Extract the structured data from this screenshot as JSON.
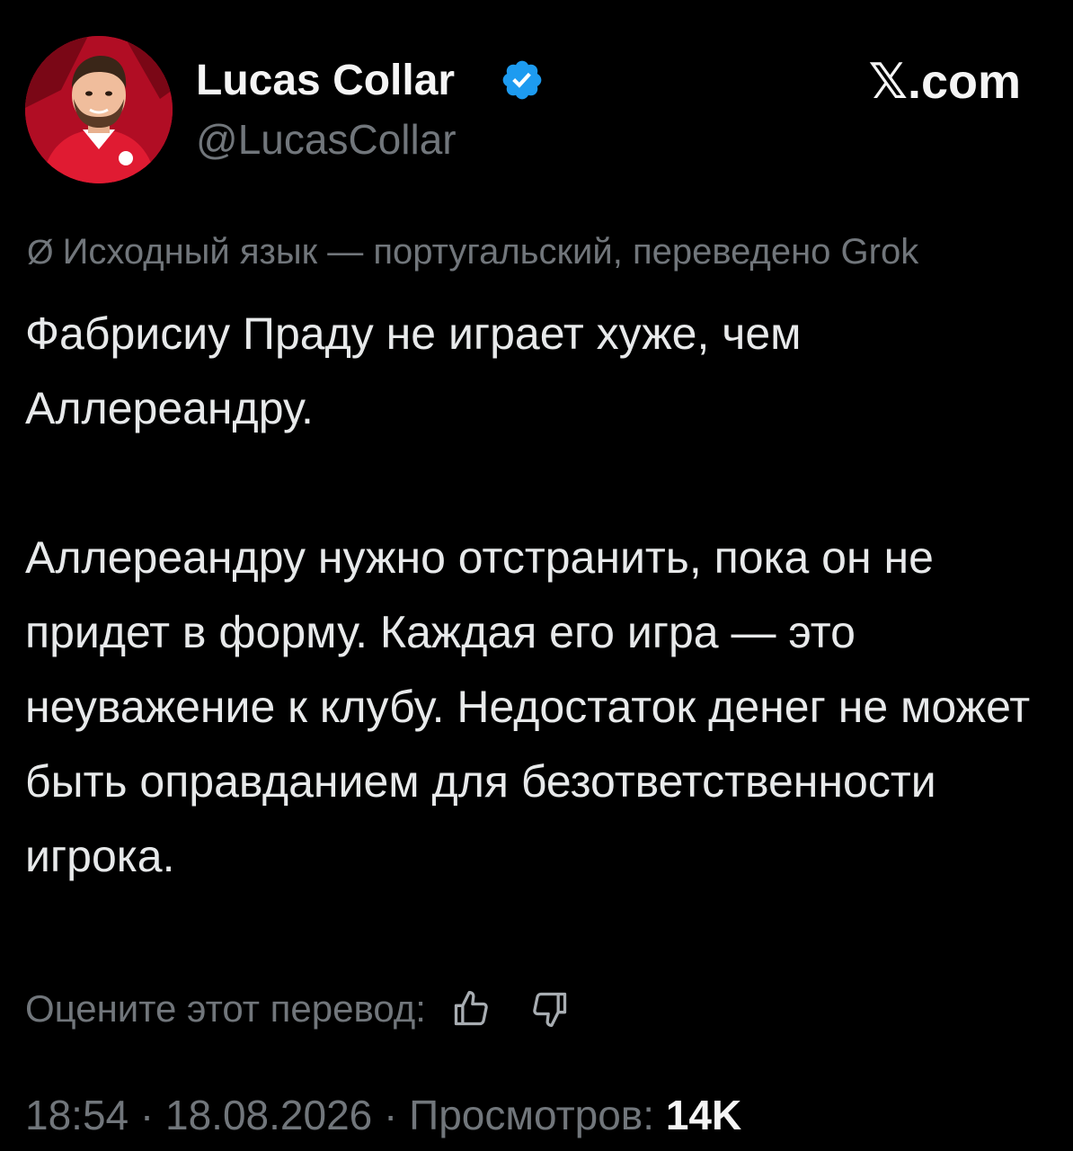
{
  "author": {
    "name": "Lucas Collar",
    "handle": "@LucasCollar",
    "verified": true
  },
  "site_label": "𝕏.com",
  "translation_note": {
    "icon": "translate-slash-icon",
    "text": "Исходный язык — португальский, переведено Grok"
  },
  "tweet": {
    "paragraphs": [
      "Фабрисиу Праду не играет хуже, чем Аллереандру.",
      "Аллереандру нужно отстранить, пока он не придет в форму. Каждая его игра — это неуважение к клубу. Недостаток денег не может быть оправданием для безответственности игрока."
    ]
  },
  "rate": {
    "label": "Оцените этот перевод:",
    "thumbs_up_icon": "thumbs-up-icon",
    "thumbs_down_icon": "thumbs-down-icon"
  },
  "meta": {
    "time": "18:54",
    "separator": " · ",
    "date": "18.08.2026",
    "views_label": "Просмотров:",
    "views_count": "14K"
  },
  "colors": {
    "background": "#000000",
    "text_primary": "#e7e9ea",
    "text_secondary": "#71767b",
    "verified_blue": "#1d9bf0",
    "avatar_red": "#c8102e"
  }
}
